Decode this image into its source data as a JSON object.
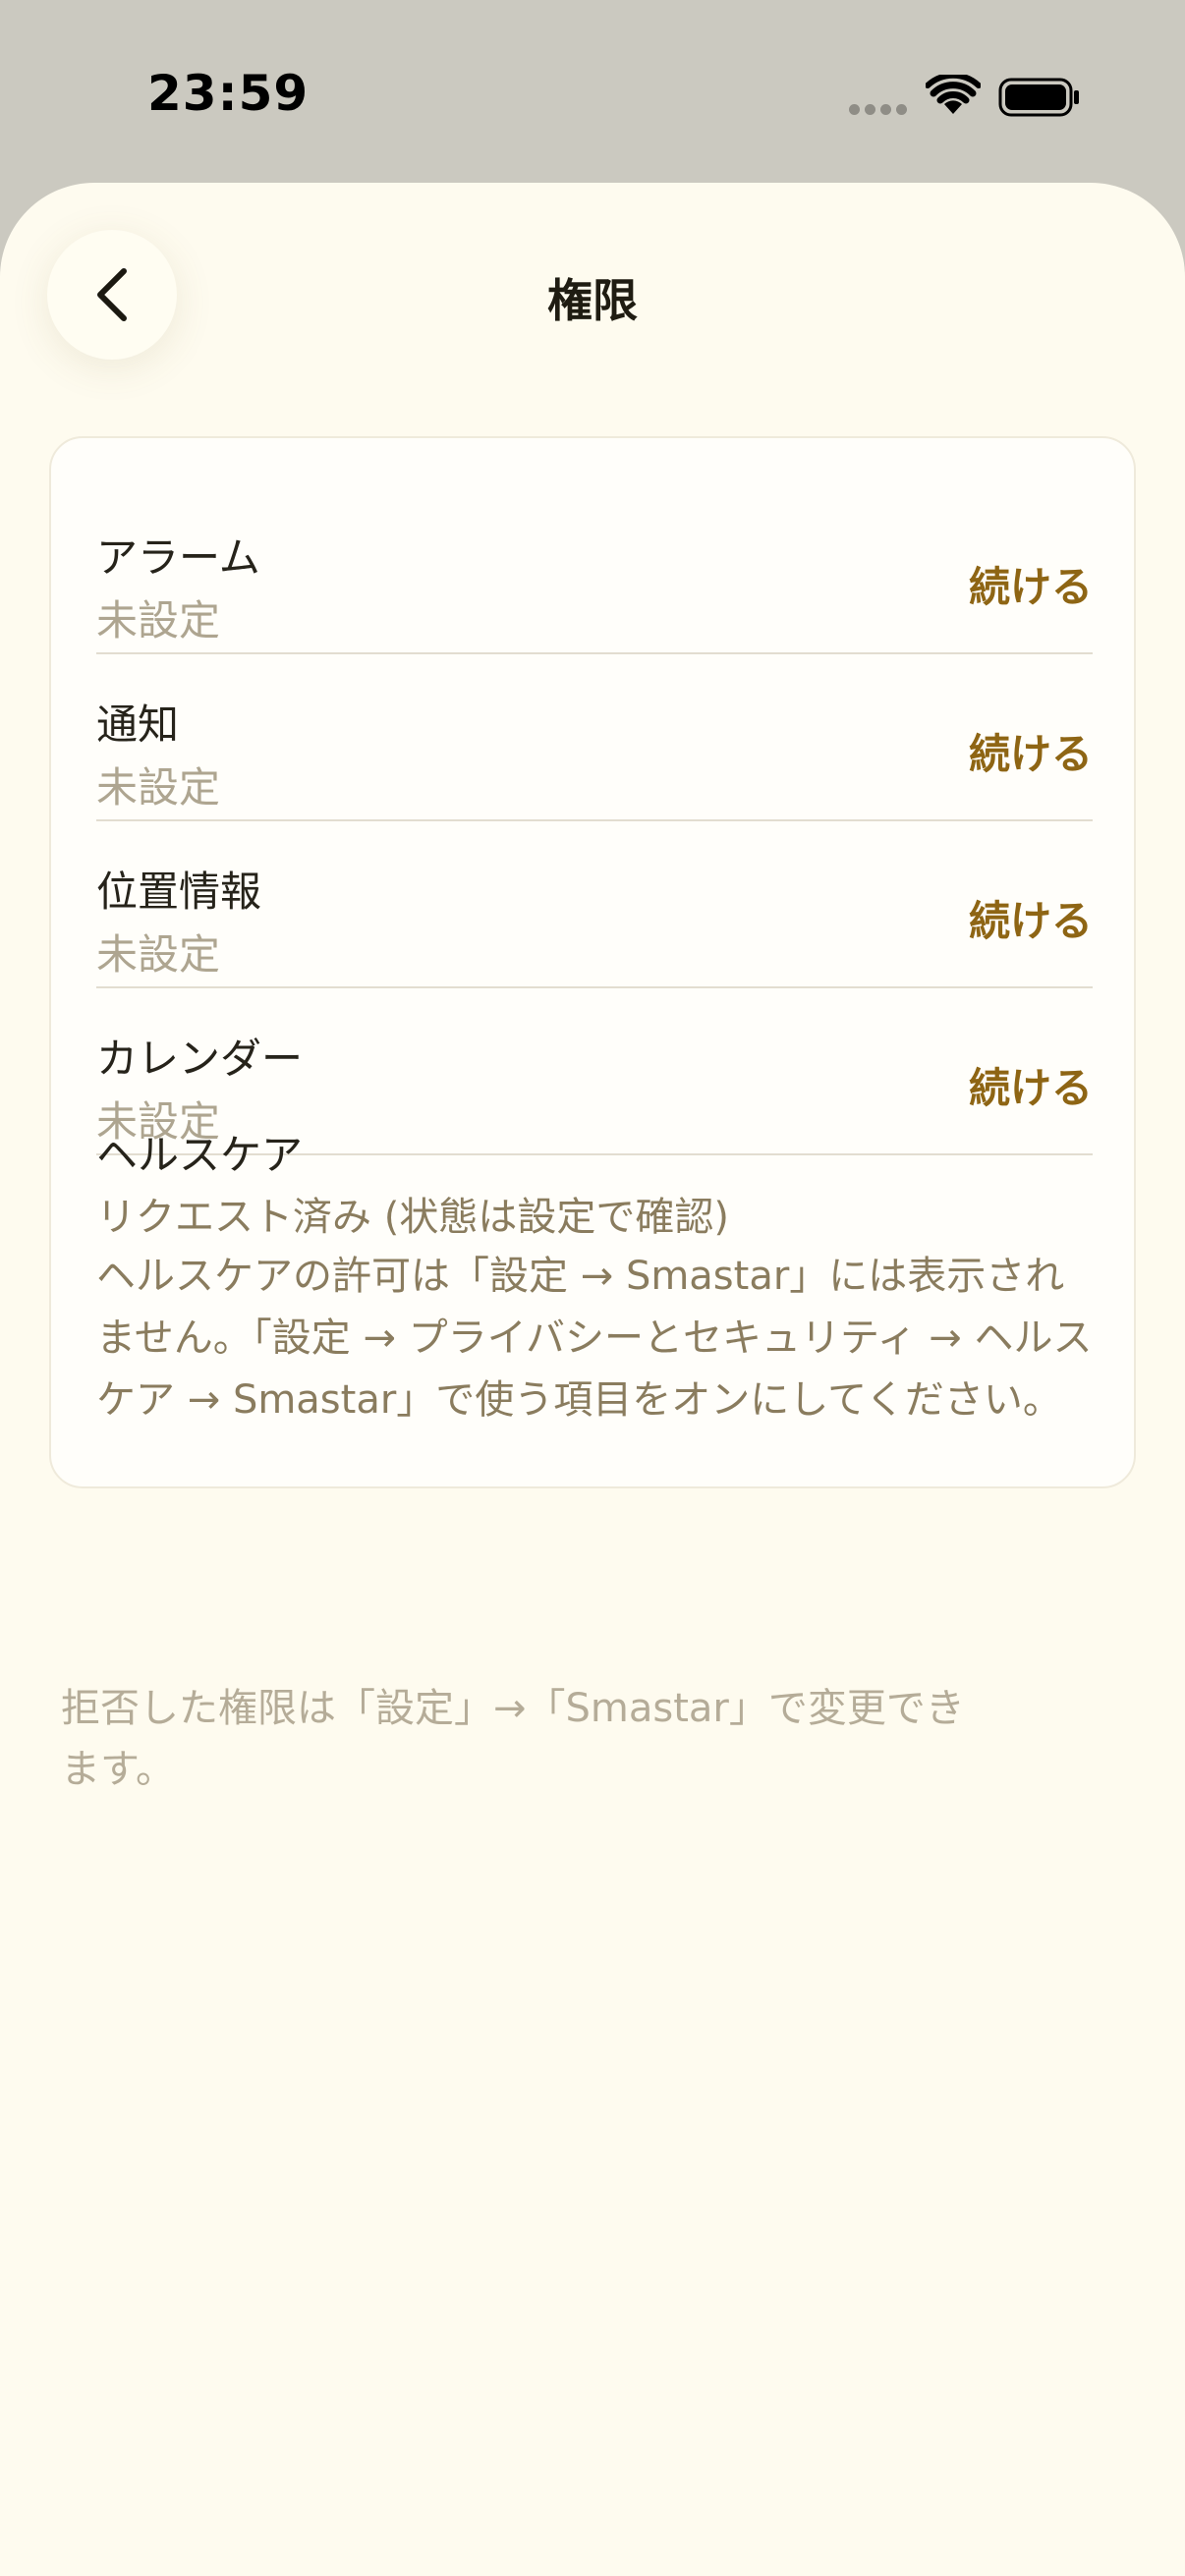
{
  "status_bar": {
    "time": "23:59"
  },
  "header": {
    "title": "権限"
  },
  "permissions": [
    {
      "label": "アラーム",
      "status": "未設定",
      "action": "続ける"
    },
    {
      "label": "通知",
      "status": "未設定",
      "action": "続ける"
    },
    {
      "label": "位置情報",
      "status": "未設定",
      "action": "続ける"
    },
    {
      "label": "カレンダー",
      "status": "未設定",
      "action": "続ける"
    }
  ],
  "health": {
    "label": "ヘルスケア",
    "status": "リクエスト済み (状態は設定で確認)",
    "note": "ヘルスケアの許可は「設定 → Smastar」には表示されません。「設定 → プライバシーとセキュリティ → ヘルスケア → Smastar」で使う項目をオンにしてください。"
  },
  "footer": {
    "note": "拒否した権限は「設定」→「Smastar」で変更できます。"
  },
  "colors": {
    "accent": "#8e6514",
    "background": "#fefbef",
    "muted": "#aea590"
  }
}
